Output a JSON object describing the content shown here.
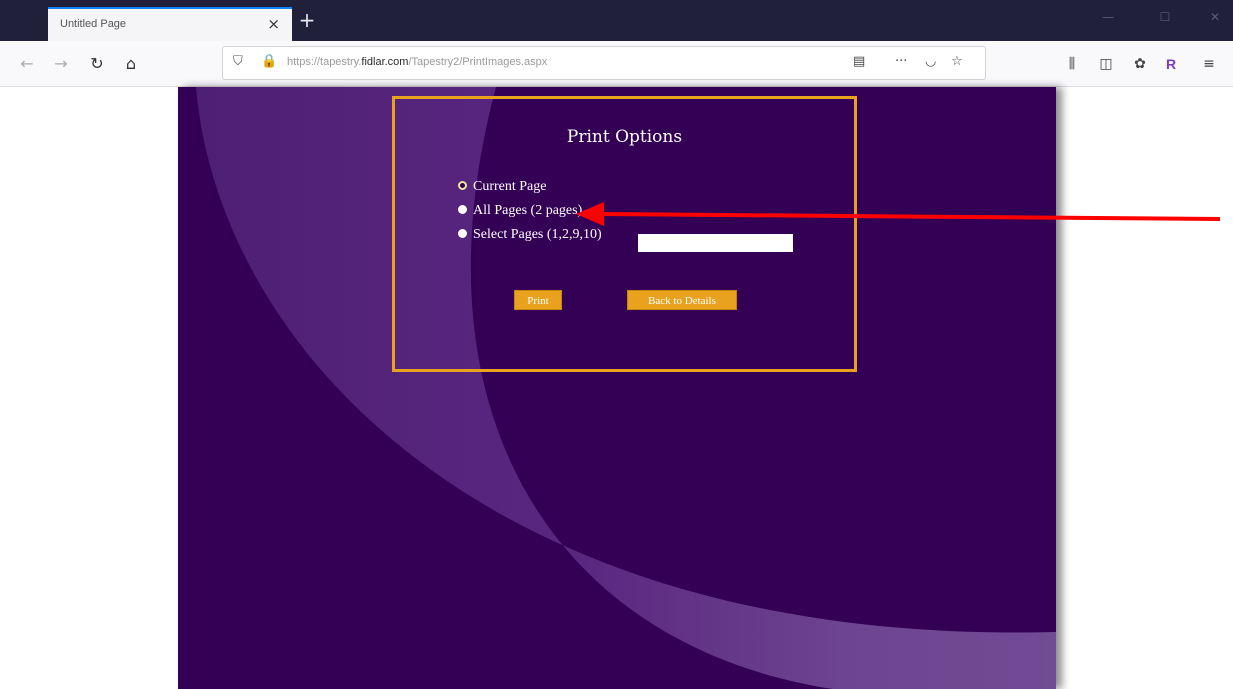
{
  "browser": {
    "tab_title": "Untitled Page",
    "tab_close": "×",
    "new_tab": "+",
    "window_controls": {
      "minimize": "—",
      "maximize": "☐",
      "close": "✕"
    },
    "url": {
      "prefix": "https://tapestry.",
      "domain": "fidlar.com",
      "path": "/Tapestry2/PrintImages.aspx"
    },
    "icons": {
      "back": "back-arrow-icon",
      "forward": "forward-arrow-icon",
      "reload": "reload-icon",
      "home": "home-icon",
      "shield": "tracking-shield-icon",
      "lock": "lock-icon",
      "reader": "reader-view-icon",
      "more": "page-actions-icon",
      "pocket": "pocket-icon",
      "star": "bookmark-star-icon",
      "library": "library-icon",
      "sidebar": "sidebar-icon",
      "extension": "extension-icon",
      "addon": "addon-r-icon",
      "menu": "hamburger-menu-icon"
    }
  },
  "print_options": {
    "title": "Print Options",
    "options": [
      {
        "label": "Current Page",
        "selected": true
      },
      {
        "label": "All Pages (2 pages)",
        "selected": false
      },
      {
        "label": "Select Pages (1,2,9,10)",
        "selected": false
      }
    ],
    "pages_input": {
      "value": ""
    },
    "print_button": "Print",
    "back_button": "Back to Details"
  },
  "colors": {
    "page_bg": "#330056",
    "swoosh": "#5a2780",
    "accent_gold": "#e8a21e",
    "annotation_arrow": "#ff0000"
  }
}
